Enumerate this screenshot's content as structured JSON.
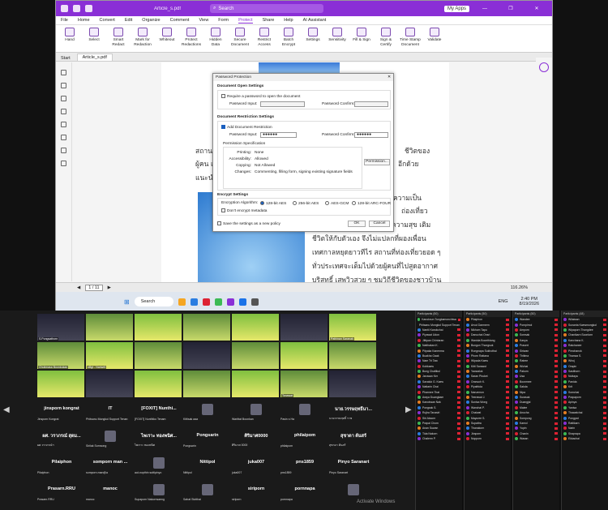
{
  "window": {
    "title": "Article_s.pdf",
    "search_placeholder": "Search",
    "my_apps": "My Apps",
    "controls": [
      "—",
      "❐",
      "✕"
    ]
  },
  "menu": [
    "File",
    "Home",
    "Convert",
    "Edit",
    "Organize",
    "Comment",
    "View",
    "Form",
    "Protect",
    "Share",
    "Help",
    "AI Assistant"
  ],
  "menu_active": "Protect",
  "ribbon": [
    "Hand",
    "Select",
    "Smart Redact",
    "Mark for Redaction",
    "Whiteout",
    "Protect Redactions",
    "Hidden Data",
    "Secure Document",
    "Restrict Access",
    "Batch Encrypt",
    "Settings",
    "Sensitivity",
    "Fill & Sign",
    "Sign & Certify",
    "Time Stamp Document",
    "Validate"
  ],
  "tabs": [
    "Start",
    "Article_s.pdf"
  ],
  "doc_text": [
    "สถานที่",
    "ผู้คน แ",
    "แนะนำ",
    "อีกด้วย",
    "ชีวิตของ",
    "ถ่องเที่ยว",
    "ความสุข เติม",
    "ชีวิตให้กับตัวเอง จึงไม่แปลกที่ผองเพื่อน",
    "เทศกาลหยุดยาวทีไร สถานที่ท่องเที่ยวยอด ๆ",
    "ทั่วประเทศจะเต็มไปด้วยผู้คนที่ไปสูดอากาศ",
    "บริสุทธิ์ เสพวิวสวย ๆ ชมวิถีชีวิตของชาวบ้าน",
    "มาปรับ",
    "ความเป็น"
  ],
  "status": {
    "page": "1 / 11",
    "zoom": "116.26%"
  },
  "taskbar": {
    "search": "Search",
    "time": "2:40 PM",
    "date": "8/19/2026",
    "lang": "ENG"
  },
  "dialog": {
    "title": "Password Protection",
    "close": "✕",
    "open_section": "Document Open Settings",
    "require_open": "Require a password to open the document",
    "password_input": "Password Input:",
    "password_confirm": "Password Confirm:",
    "restrict_section": "Document Restriction Settings",
    "add_restriction": "Add Document Restriction",
    "pw_mask": "●●●●●●",
    "perm_title": "Permission Specification",
    "perms": [
      [
        "Printing:",
        "None"
      ],
      [
        "Accessibility:",
        "Allowed"
      ],
      [
        "Copying:",
        "Not Allowed"
      ],
      [
        "Changes:",
        "Commenting, filling form, signing existing signature fields"
      ]
    ],
    "permission_btn": "Permission...",
    "encrypt_section": "Encrypt Settings",
    "encrypt_label": "Encryption Algorithm:",
    "algos": [
      "128-bit AES",
      "256-bit AES",
      "AES-GCM",
      "128-bit ARC-FOUR"
    ],
    "dont_encrypt": "Don't encrypt metadata",
    "save_new": "Save the settings as a new policy",
    "ok": "OK",
    "cancel": "Cancel"
  },
  "meeting": {
    "videos": [
      "S.Pongsathorn",
      "",
      "",
      "",
      "",
      "",
      "Pathinan Saranak",
      "Chutimasa Boonkukan",
      "nBgt - Nariwrit",
      "",
      "",
      "",
      "",
      "",
      "",
      "",
      "",
      "",
      "",
      "Tanawat",
      "",
      "",
      "",
      "",
      "",
      ""
    ],
    "tiles": [
      {
        "n": "jinsporn kongrat",
        "s": "Jinsporn Kongrat"
      },
      {
        "n": "IT",
        "s": "Phitsanu Mongkol Support Tenan"
      },
      {
        "n": "[FOXIT] Nunthi...",
        "s": "[FOXIT] Nunthiko Tenam"
      },
      {
        "n": "",
        "s": "Kittisak aaa"
      },
      {
        "n": "",
        "s": "Warittat Boonkan"
      },
      {
        "n": "",
        "s": "Pasin s Ha"
      },
      {
        "n": "นาย.วรรษฤทธิ์นา...",
        "s": "นายวรรษฤทธิ์ ราช"
      },
      {
        "n": "ผศ. วราภรณ์ สุดม...",
        "s": "ผศ.วราภรณ์ฯ"
      },
      {
        "n": "",
        "s": "Sirilak Somsong"
      },
      {
        "n": "ไพเราะ ทองพนิศ...",
        "s": "ไพเราะ ทองพนิศ"
      },
      {
        "n": "Pongsarin",
        "s": "Pongsarin"
      },
      {
        "n": "ศิริมาศ0000",
        "s": "ศิริมาศ 0000"
      },
      {
        "n": "philaipom",
        "s": "philaipom"
      },
      {
        "n": "สุชาดา ต้นสร้",
        "s": "สุชาดา ต้นสร้"
      },
      {
        "n": "Pilaiphon",
        "s": "Pilaiphon"
      },
      {
        "n": "somporn man ...",
        "s": "somporn.man@a"
      },
      {
        "n": "",
        "s": "aut-nopthin suttipinyo"
      },
      {
        "n": "Nittipol",
        "s": "Nittipol"
      },
      {
        "n": "juka007",
        "s": "juka007"
      },
      {
        "n": "pns1859",
        "s": "pns1859"
      },
      {
        "n": "Pinyo Saranart",
        "s": "Pinyo Saranart"
      },
      {
        "n": "Prasarn.RRU",
        "s": "Prasarn.RRU"
      },
      {
        "n": "manoc",
        "s": "manoc"
      },
      {
        "n": "",
        "s": "Supaporn Nakornsaeng"
      },
      {
        "n": "",
        "s": "Sahat Stotthai"
      },
      {
        "n": "siriporn",
        "s": "siriporn"
      },
      {
        "n": "pornnapa",
        "s": "pornnapa"
      },
      {
        "n": "",
        "s": ""
      }
    ],
    "watermark": "Activate Windows"
  },
  "panels": [
    {
      "head": "Participants (50)",
      "rows": [
        "Kanoknun Tungkamonchiwa",
        "Phitsanu Mongkol Support Tenan",
        "Nantii Kanokchai",
        "Piyawat Udon",
        "Jittipan Chintaran",
        "Natthakan K.",
        "Pitpaka Kanenma",
        "Buakha Oaak",
        "Nam Tri Taw",
        "Kobkaew",
        "Bung Chalitkul",
        "Jaruwan Ker",
        "Savaluk G. Kaew",
        "Nattarin Chai",
        "Phannee Tirat",
        "Araya Duangkam",
        "Kanokwan Nak",
        "Pongsak S.",
        "Rujira Tanasiri",
        "Siri Aksorn",
        "Prapai Chom",
        "Anan Suwan",
        "Tida Nakorn",
        "Chalerm P."
      ]
    },
    {
      "head": "Participants (50)",
      "rows": [
        "Pilaiphon",
        "Arvut Damnern",
        "Nikhom Tapu",
        "Danuchai Onsri",
        "Wanida Boonthiang",
        "Bungon Thongsuk",
        "Rungnapa Sukhothai",
        "Phorn Rattana",
        "Wipada Kaew",
        "Kitti Sarawut",
        "Yaowaluk",
        "Saran Phuket",
        "Oranuch K.",
        "Piyathida",
        "Naruemon",
        "Teerawat J.",
        "Sunisa Wong",
        "Wanchai P.",
        "Chaiwat",
        "Mayuree S.",
        "Supattra",
        "Thanakorn",
        "Jiraporn",
        "Nopporn"
      ]
    },
    {
      "head": "Participants (50)",
      "rows": [
        "Wandee",
        "Pornpimol",
        "Amporn",
        "Somsak",
        "Kanya",
        "Prasert",
        "Siriwan",
        "Thitima",
        "Ratree",
        "Wichai",
        "Pakorn",
        "Usa",
        "Boonmee",
        "Sakda",
        "Nipa",
        "Surasak",
        "Duangjai",
        "Malee",
        "Anucha",
        "Sompong",
        "Kamol",
        "Yupin",
        "Chanin",
        "Wasan"
      ]
    },
    {
      "head": "Participants (48)",
      "rows": [
        "Wilaiwan",
        "Sunanta Kaewmongkol",
        "Wipaporn Thongdee",
        "Chanikarn Soontorn",
        "Kanchana K.",
        "Ratchanee",
        "Pimchanok",
        "Thanwa S.",
        "Wiroj",
        "Orapin",
        "Sasithorn",
        "Nuttaya",
        "Panida",
        "Krit",
        "Somchai",
        "Prapaporn",
        "Apinya",
        "Yanisa",
        "Thawatchai",
        "Pongpat",
        "Rattikarn",
        "Narin",
        "Siraprapa",
        "Ekkachai"
      ]
    }
  ]
}
